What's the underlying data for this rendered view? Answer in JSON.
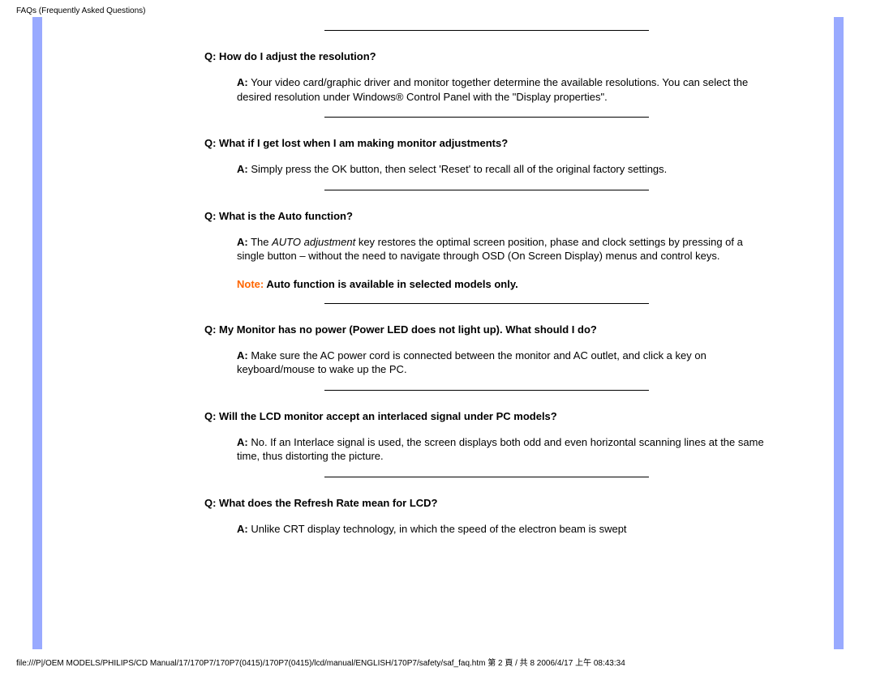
{
  "header": {
    "title": "FAQs (Frequently Asked Questions)"
  },
  "faqs": [
    {
      "question": "Q: How do I adjust the resolution?",
      "a_lead": "A:",
      "answer_html": "Your video card/graphic driver and monitor together determine the available resolutions. You can select the desired resolution under Windows® Control Panel with the \"Display properties\"."
    },
    {
      "question": "Q: What if I get lost when I am making monitor adjustments?",
      "a_lead": "A:",
      "answer_html": "Simply press the OK button, then select 'Reset' to recall all of the original factory settings."
    },
    {
      "question": "Q: What is the Auto function?",
      "a_lead": "A:",
      "answer_pre": "The ",
      "answer_em": "AUTO adjustment",
      "answer_post": " key restores the optimal screen position, phase and clock settings by pressing of a single button – without the need to navigate through OSD (On Screen Display) menus and control keys.",
      "note_label": "Note: ",
      "note_text": "Auto function is available in selected models only."
    },
    {
      "question": "Q: My Monitor has no power (Power LED does not light up). What should I do?",
      "a_lead": "A:",
      "answer_html": "Make sure the AC power cord is connected between the monitor and AC outlet, and click a key on keyboard/mouse to wake up the PC."
    },
    {
      "question": "Q: Will the LCD monitor accept an interlaced signal under PC models?",
      "a_lead": "A:",
      "answer_html": "No. If an Interlace signal is used, the screen displays both odd and even horizontal scanning lines at the same time, thus distorting the picture."
    },
    {
      "question": "Q: What does the Refresh Rate mean for LCD?",
      "a_lead": "A:",
      "answer_html": "Unlike CRT display technology, in which the speed of the electron beam is swept"
    }
  ],
  "footer": {
    "text": "file:///P|/OEM MODELS/PHILIPS/CD Manual/17/170P7/170P7(0415)/170P7(0415)/lcd/manual/ENGLISH/170P7/safety/saf_faq.htm 第 2 頁 / 共 8 2006/4/17 上午 08:43:34"
  }
}
